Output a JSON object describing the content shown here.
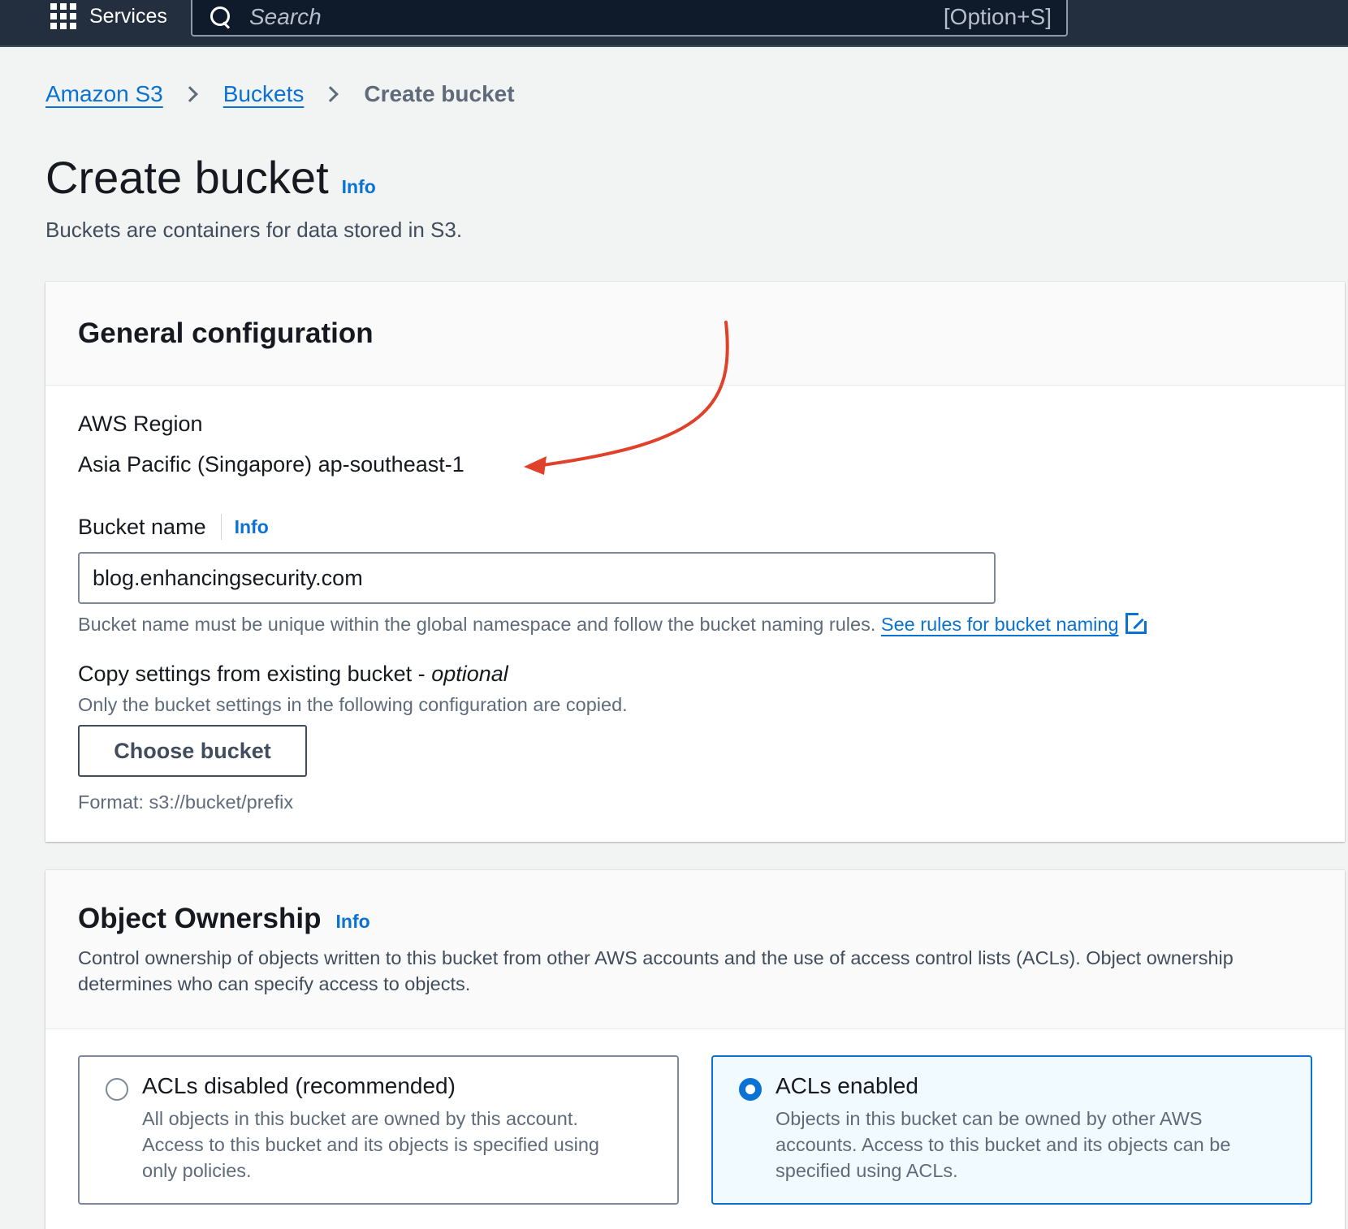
{
  "topbar": {
    "services_label": "Services",
    "search_placeholder": "Search",
    "search_shortcut": "[Option+S]"
  },
  "breadcrumb": [
    {
      "label": "Amazon S3"
    },
    {
      "label": "Buckets"
    },
    {
      "label": "Create bucket"
    }
  ],
  "page": {
    "title": "Create bucket",
    "info_label": "Info",
    "description": "Buckets are containers for data stored in S3."
  },
  "general_config": {
    "title": "General configuration",
    "region_label": "AWS Region",
    "region_value": "Asia Pacific (Singapore) ap-southeast-1",
    "bucket_name_label": "Bucket name",
    "info_label": "Info",
    "bucket_name_value": "blog.enhancingsecurity.com",
    "bucket_name_help": "Bucket name must be unique within the global namespace and follow the bucket naming rules.",
    "naming_rules_link": "See rules for bucket naming",
    "copy_settings_label": "Copy settings from existing bucket - ",
    "copy_settings_optional": "optional",
    "copy_settings_desc": "Only the bucket settings in the following configuration are copied.",
    "choose_bucket_label": "Choose bucket",
    "format_hint": "Format: s3://bucket/prefix"
  },
  "object_ownership": {
    "title": "Object Ownership",
    "info_label": "Info",
    "description": "Control ownership of objects written to this bucket from other AWS accounts and the use of access control lists (ACLs). Object ownership determines who can specify access to objects.",
    "options": [
      {
        "title": "ACLs disabled (recommended)",
        "description": "All objects in this bucket are owned by this account. Access to this bucket and its objects is specified using only policies.",
        "selected": false
      },
      {
        "title": "ACLs enabled",
        "description": "Objects in this bucket can be owned by other AWS accounts. Access to this bucket and its objects can be specified using ACLs.",
        "selected": true
      }
    ]
  },
  "colors": {
    "nav_background": "#232f3e",
    "link_blue": "#0972d3",
    "annotation_arrow": "#e0412b"
  }
}
